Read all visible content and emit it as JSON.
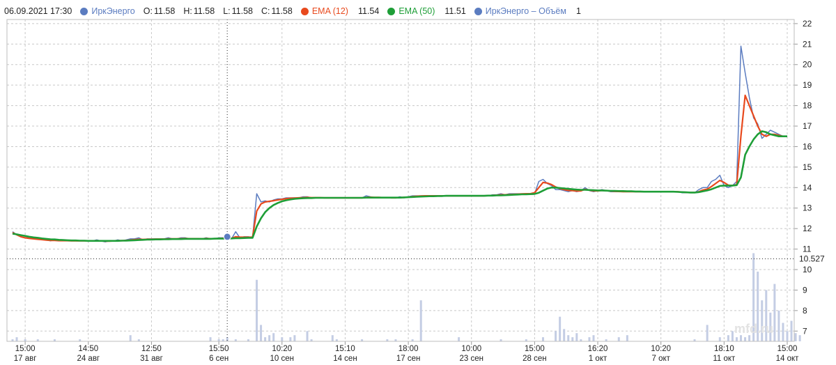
{
  "header": {
    "datetime": "06.09.2021 17:30",
    "series_name": "ИркЭнерго",
    "open_label": "O:",
    "open": "11.58",
    "high_label": "H:",
    "high": "11.58",
    "low_label": "L:",
    "low": "11.58",
    "close_label": "C:",
    "close": "11.58",
    "ema12_label": "EMA (12)",
    "ema12_value": "11.54",
    "ema50_label": "EMA (50)",
    "ema50_value": "11.51",
    "volume_label": "ИркЭнерго – Объём",
    "volume_value": "1"
  },
  "colors": {
    "price": "#5b7cc0",
    "ema12": "#e8491d",
    "ema50": "#1e9e37",
    "volume": "#c4cde4",
    "grid": "#c8c8c8"
  },
  "crosshair": {
    "price_label": "10.527",
    "price": 10.527,
    "x_index": 51
  },
  "watermark": "mfd.ru",
  "chart_data": {
    "type": "line",
    "title": "",
    "y_ticks": [
      "7",
      "8",
      "9",
      "10",
      "11",
      "12",
      "13",
      "14",
      "15",
      "16",
      "17",
      "18",
      "19",
      "20",
      "21",
      "22"
    ],
    "ylim": [
      6.5,
      22.2
    ],
    "x_ticks": [
      {
        "time": "15:00",
        "date": "17 авг",
        "i": 3
      },
      {
        "time": "14:50",
        "date": "24 авг",
        "i": 18
      },
      {
        "time": "12:50",
        "date": "31 авг",
        "i": 33
      },
      {
        "time": "15:50",
        "date": "6 сен",
        "i": 49
      },
      {
        "time": "10:20",
        "date": "10 сен",
        "i": 64
      },
      {
        "time": "15:10",
        "date": "14 сен",
        "i": 79
      },
      {
        "time": "18:00",
        "date": "17 сен",
        "i": 94
      },
      {
        "time": "10:00",
        "date": "23 сен",
        "i": 109
      },
      {
        "time": "15:00",
        "date": "28 сен",
        "i": 124
      },
      {
        "time": "16:20",
        "date": "1 окт",
        "i": 139
      },
      {
        "time": "10:20",
        "date": "7 окт",
        "i": 154
      },
      {
        "time": "18:10",
        "date": "11 окт",
        "i": 169
      },
      {
        "time": "15:00",
        "date": "14 окт",
        "i": 184
      }
    ],
    "grid": true,
    "series": [
      {
        "name": "ИркЭнерго",
        "values": [
          11.85,
          11.7,
          11.6,
          11.55,
          11.55,
          11.5,
          11.5,
          11.45,
          11.45,
          11.4,
          11.45,
          11.4,
          11.45,
          11.4,
          11.4,
          11.4,
          11.4,
          11.4,
          11.4,
          11.4,
          11.45,
          11.4,
          11.35,
          11.4,
          11.4,
          11.45,
          11.4,
          11.45,
          11.5,
          11.5,
          11.55,
          11.45,
          11.5,
          11.5,
          11.5,
          11.5,
          11.5,
          11.55,
          11.5,
          11.5,
          11.55,
          11.55,
          11.5,
          11.5,
          11.5,
          11.5,
          11.55,
          11.5,
          11.5,
          11.55,
          11.55,
          11.6,
          11.5,
          11.85,
          11.55,
          11.6,
          11.6,
          11.55,
          13.7,
          13.3,
          13.35,
          13.3,
          13.4,
          13.45,
          13.45,
          13.5,
          13.5,
          13.5,
          13.5,
          13.55,
          13.55,
          13.5,
          13.5,
          13.5,
          13.5,
          13.5,
          13.5,
          13.5,
          13.5,
          13.5,
          13.5,
          13.5,
          13.5,
          13.5,
          13.6,
          13.55,
          13.5,
          13.5,
          13.5,
          13.5,
          13.5,
          13.5,
          13.55,
          13.5,
          13.55,
          13.6,
          13.6,
          13.6,
          13.6,
          13.6,
          13.6,
          13.6,
          13.6,
          13.6,
          13.6,
          13.6,
          13.6,
          13.6,
          13.6,
          13.6,
          13.6,
          13.6,
          13.6,
          13.6,
          13.65,
          13.65,
          13.7,
          13.65,
          13.7,
          13.7,
          13.7,
          13.7,
          13.7,
          13.7,
          13.7,
          14.3,
          14.4,
          14.2,
          14.1,
          13.9,
          13.9,
          13.85,
          13.8,
          13.85,
          13.8,
          13.85,
          14.0,
          13.85,
          13.8,
          13.85,
          13.9,
          13.85,
          13.8,
          13.8,
          13.8,
          13.8,
          13.8,
          13.8,
          13.8,
          13.8,
          13.8,
          13.8,
          13.8,
          13.8,
          13.8,
          13.8,
          13.8,
          13.8,
          13.8,
          13.75,
          13.75,
          13.75,
          13.75,
          13.9,
          14.0,
          14.0,
          14.3,
          14.4,
          14.6,
          14.1,
          14.0,
          14.1,
          14.3,
          20.9,
          19.6,
          18.4,
          17.4,
          17.1,
          16.4,
          16.6,
          16.8,
          16.7,
          16.6,
          16.5,
          16.5
        ]
      },
      {
        "name": "EMA (12)",
        "values": [
          11.8,
          11.7,
          11.6,
          11.55,
          11.52,
          11.5,
          11.48,
          11.46,
          11.44,
          11.42,
          11.42,
          11.41,
          11.41,
          11.41,
          11.4,
          11.4,
          11.4,
          11.4,
          11.4,
          11.4,
          11.41,
          11.4,
          11.39,
          11.39,
          11.4,
          11.41,
          11.41,
          11.42,
          11.44,
          11.46,
          11.48,
          11.47,
          11.48,
          11.48,
          11.49,
          11.49,
          11.49,
          11.5,
          11.5,
          11.5,
          11.51,
          11.52,
          11.51,
          11.51,
          11.51,
          11.5,
          11.52,
          11.51,
          11.51,
          11.52,
          11.53,
          11.54,
          11.53,
          11.6,
          11.58,
          11.58,
          11.58,
          11.58,
          12.85,
          13.2,
          13.3,
          13.33,
          13.36,
          13.4,
          13.43,
          13.46,
          13.48,
          13.49,
          13.5,
          13.51,
          13.52,
          13.51,
          13.51,
          13.51,
          13.5,
          13.5,
          13.5,
          13.5,
          13.5,
          13.5,
          13.5,
          13.5,
          13.5,
          13.5,
          13.52,
          13.53,
          13.52,
          13.52,
          13.51,
          13.51,
          13.5,
          13.5,
          13.51,
          13.52,
          13.53,
          13.56,
          13.58,
          13.59,
          13.6,
          13.6,
          13.6,
          13.6,
          13.6,
          13.6,
          13.6,
          13.6,
          13.6,
          13.6,
          13.6,
          13.6,
          13.6,
          13.6,
          13.6,
          13.61,
          13.62,
          13.63,
          13.65,
          13.65,
          13.66,
          13.67,
          13.68,
          13.69,
          13.7,
          13.7,
          13.75,
          14.0,
          14.25,
          14.22,
          14.15,
          14.03,
          13.95,
          13.9,
          13.86,
          13.85,
          13.83,
          13.84,
          13.92,
          13.87,
          13.84,
          13.84,
          13.86,
          13.85,
          13.83,
          13.82,
          13.81,
          13.8,
          13.8,
          13.8,
          13.8,
          13.8,
          13.8,
          13.8,
          13.8,
          13.8,
          13.8,
          13.8,
          13.8,
          13.8,
          13.8,
          13.78,
          13.77,
          13.76,
          13.76,
          13.8,
          13.88,
          13.93,
          14.05,
          14.2,
          14.35,
          14.25,
          14.12,
          14.1,
          14.15,
          16.5,
          18.5,
          18.0,
          17.5,
          17.0,
          16.6,
          16.5,
          16.6,
          16.6,
          16.55,
          16.5,
          16.5
        ]
      },
      {
        "name": "EMA (50)",
        "values": [
          11.75,
          11.72,
          11.68,
          11.64,
          11.6,
          11.57,
          11.55,
          11.52,
          11.5,
          11.48,
          11.47,
          11.45,
          11.44,
          11.43,
          11.42,
          11.42,
          11.41,
          11.41,
          11.4,
          11.4,
          11.4,
          11.4,
          11.4,
          11.4,
          11.4,
          11.4,
          11.41,
          11.41,
          11.42,
          11.43,
          11.44,
          11.45,
          11.46,
          11.46,
          11.47,
          11.47,
          11.48,
          11.48,
          11.49,
          11.49,
          11.49,
          11.5,
          11.5,
          11.5,
          11.5,
          11.5,
          11.5,
          11.5,
          11.51,
          11.51,
          11.51,
          11.52,
          11.52,
          11.53,
          11.53,
          11.54,
          11.55,
          11.55,
          12.1,
          12.5,
          12.8,
          13.0,
          13.15,
          13.25,
          13.33,
          13.38,
          13.42,
          13.45,
          13.47,
          13.48,
          13.49,
          13.49,
          13.5,
          13.5,
          13.5,
          13.5,
          13.5,
          13.5,
          13.5,
          13.5,
          13.5,
          13.5,
          13.5,
          13.5,
          13.51,
          13.51,
          13.51,
          13.51,
          13.51,
          13.51,
          13.51,
          13.51,
          13.51,
          13.52,
          13.53,
          13.54,
          13.55,
          13.56,
          13.57,
          13.58,
          13.58,
          13.59,
          13.59,
          13.6,
          13.6,
          13.6,
          13.6,
          13.6,
          13.6,
          13.6,
          13.6,
          13.6,
          13.6,
          13.61,
          13.61,
          13.62,
          13.62,
          13.63,
          13.64,
          13.65,
          13.66,
          13.67,
          13.67,
          13.68,
          13.69,
          13.75,
          13.85,
          13.95,
          14.0,
          14.0,
          13.98,
          13.96,
          13.94,
          13.92,
          13.9,
          13.89,
          13.89,
          13.88,
          13.87,
          13.86,
          13.86,
          13.85,
          13.84,
          13.84,
          13.83,
          13.83,
          13.82,
          13.82,
          13.81,
          13.81,
          13.8,
          13.8,
          13.8,
          13.8,
          13.8,
          13.8,
          13.8,
          13.8,
          13.79,
          13.78,
          13.77,
          13.76,
          13.76,
          13.78,
          13.82,
          13.86,
          13.92,
          14.0,
          14.08,
          14.1,
          14.1,
          14.1,
          14.12,
          14.5,
          15.6,
          16.0,
          16.35,
          16.6,
          16.75,
          16.7,
          16.6,
          16.55,
          16.5,
          16.5,
          16.5
        ]
      }
    ],
    "volume": {
      "name": "ИркЭнерго – Объём",
      "values": [
        0.1,
        0.2,
        0,
        0.1,
        0,
        0,
        0.1,
        0,
        0,
        0,
        0.1,
        0,
        0,
        0,
        0,
        0,
        0.1,
        0,
        0,
        0,
        0,
        0,
        0,
        0,
        0,
        0,
        0,
        0,
        0.3,
        0,
        0.1,
        0,
        0,
        0,
        0,
        0,
        0,
        0,
        0,
        0,
        0,
        0,
        0,
        0,
        0,
        0,
        0,
        0.2,
        0,
        0.1,
        0.1,
        0.2,
        0,
        0.1,
        0,
        0,
        0.1,
        0,
        3.0,
        0.8,
        0.2,
        0.3,
        0.4,
        0,
        0.2,
        0,
        0.2,
        0.3,
        0,
        0,
        0.5,
        0.1,
        0,
        0,
        0,
        0,
        0.3,
        0.1,
        0,
        0,
        0,
        0,
        0,
        0.1,
        0,
        0,
        0,
        0,
        0,
        0.1,
        0,
        0.1,
        0,
        0,
        0,
        0.1,
        0,
        2.0,
        0,
        0,
        0,
        0,
        0,
        0,
        0,
        0,
        0.2,
        0,
        0,
        0,
        0,
        0,
        0,
        0,
        0,
        0,
        0.1,
        0,
        0,
        0,
        0,
        0,
        0.1,
        0,
        0,
        0,
        0.2,
        0,
        0,
        0.5,
        1.2,
        0.6,
        0.3,
        0.2,
        0.4,
        0.1,
        0,
        0.2,
        0.3,
        0,
        0,
        0.1,
        0,
        0,
        0.2,
        0,
        0.3,
        0,
        0,
        0,
        0,
        0,
        0,
        0,
        0,
        0,
        0,
        0,
        0,
        0,
        0,
        0,
        0.1,
        0,
        0,
        0.8,
        0,
        0,
        0.2,
        0,
        0.3,
        0.5,
        0.2,
        0.3,
        0.2,
        0.3,
        4.3,
        3.4,
        2.0,
        2.5,
        1.4,
        2.8,
        1.5,
        0.9,
        0.5,
        1.0,
        0.4,
        0.3
      ]
    }
  }
}
